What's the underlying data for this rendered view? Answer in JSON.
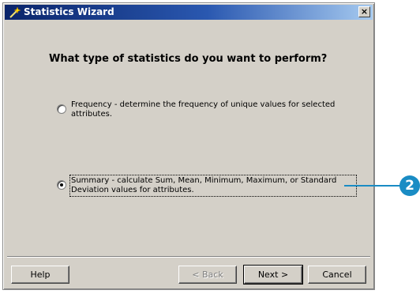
{
  "window": {
    "title": "Statistics Wizard",
    "close_symbol": "×"
  },
  "question": "What type of statistics do you want to perform?",
  "options": [
    {
      "line1": "Frequency - determine the frequency of unique values for selected",
      "line2": "attributes.",
      "selected": false
    },
    {
      "line1": "Summary - calculate Sum, Mean, Minimum, Maximum, or Standard",
      "line2": "Deviation values for attributes.",
      "selected": true
    }
  ],
  "buttons": {
    "help": "Help",
    "back": "< Back",
    "next": "Next >",
    "cancel": "Cancel"
  },
  "callout": {
    "number": "2",
    "color": "#1a8cc4"
  },
  "colors": {
    "titlebar_start": "#0a246a",
    "titlebar_end": "#a6caf0",
    "dialog_bg": "#d4d0c8"
  }
}
